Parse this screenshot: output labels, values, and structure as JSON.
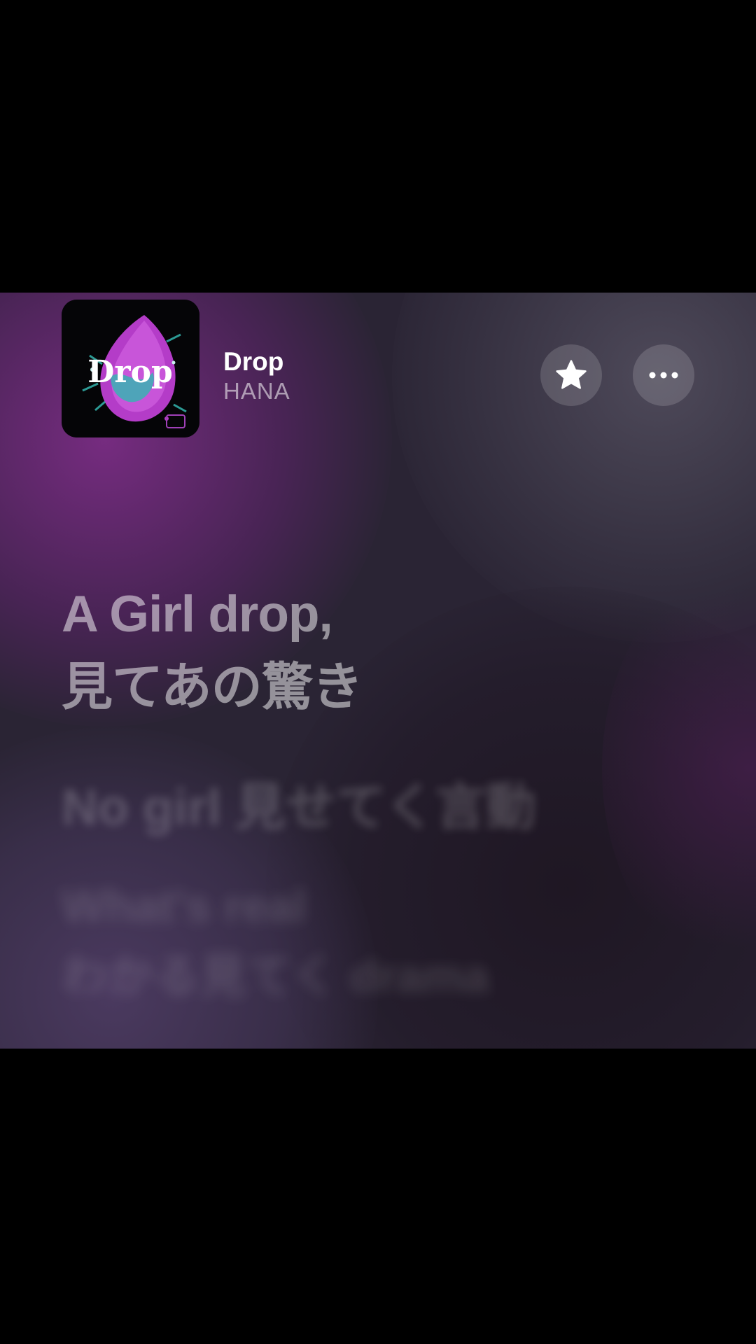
{
  "now_playing": {
    "title": "Drop",
    "artist": "HANA",
    "artwork_text": "Drop",
    "favorite_icon": "star-icon",
    "more_icon": "ellipsis-icon"
  },
  "lyrics": {
    "current": [
      "A Girl drop,",
      "見てあの驚き"
    ],
    "next": [
      "No girl 見せてく言動"
    ],
    "after": [
      "What's real",
      "わかる見てく drama"
    ]
  },
  "colors": {
    "background": "#2a2434",
    "accent_purple": "#7a2c84",
    "text_primary": "#ffffff"
  }
}
